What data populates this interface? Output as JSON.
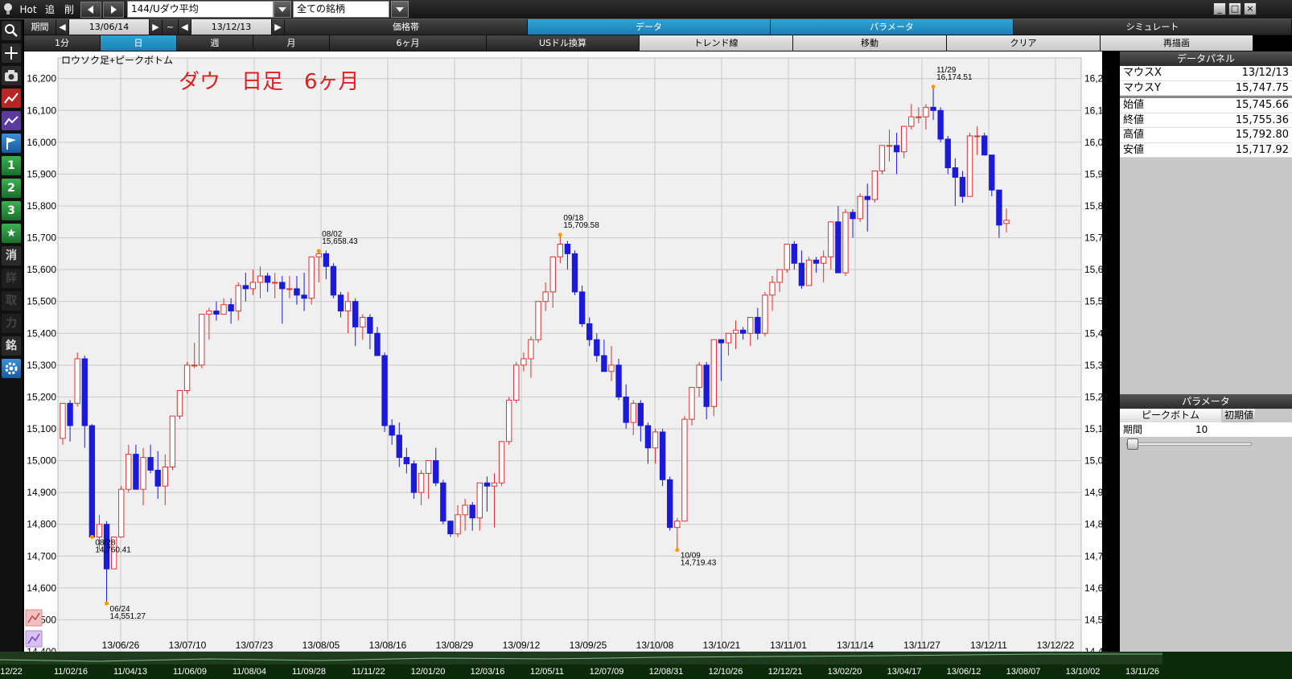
{
  "topbar": {
    "hot": "Hot",
    "add": "追",
    "del": "削",
    "symbol": "144/Uダウ平均",
    "universe": "全ての銘柄"
  },
  "toolbar_row1": {
    "period_label": "期間",
    "from": "13/06/14",
    "tilde": "~",
    "to": "13/12/13",
    "price_band": "価格帯",
    "data": "データ",
    "params": "パラメータ",
    "simulate": "シミュレート"
  },
  "toolbar_row2": {
    "min1": "1分",
    "day": "日",
    "week": "週",
    "month": "月",
    "m6": "6ヶ月",
    "usd": "USドル換算",
    "trend": "トレンド線",
    "move": "移動",
    "clear": "クリア",
    "redraw": "再描画"
  },
  "chart": {
    "legend": "ロウソク足+ピークボトム",
    "title": "ダウ　日足　6ヶ月"
  },
  "data_panel": {
    "title": "データパネル",
    "mouse_x_label": "マウスX",
    "mouse_x": "13/12/13",
    "mouse_y_label": "マウスY",
    "mouse_y": "15,747.75",
    "open_label": "始値",
    "open": "15,745.66",
    "close_label": "終値",
    "close": "15,755.36",
    "high_label": "高値",
    "high": "15,792.80",
    "low_label": "安値",
    "low": "15,717.92"
  },
  "param_panel": {
    "title": "パラメータ",
    "tab": "ピークボトム",
    "init": "初期値",
    "period_label": "期間",
    "period_value": "10"
  },
  "bottom_dates": [
    "12/22",
    "11/02/16",
    "11/04/13",
    "11/06/09",
    "11/08/04",
    "11/09/28",
    "11/11/22",
    "12/01/20",
    "12/03/16",
    "12/05/11",
    "12/07/09",
    "12/08/31",
    "12/10/26",
    "12/12/21",
    "13/02/20",
    "13/04/17",
    "13/06/12",
    "13/08/07",
    "13/10/02",
    "13/11/26"
  ],
  "colors": {
    "up": "#e03030",
    "down": "#1a1ad8",
    "peak": "#ff9900",
    "title": "#e02020"
  },
  "chart_data": {
    "type": "candlestick",
    "yticks": [
      14400,
      14500,
      14600,
      14700,
      14800,
      14900,
      15000,
      15100,
      15200,
      15300,
      15400,
      15500,
      15600,
      15700,
      15800,
      15900,
      16000,
      16100,
      16200
    ],
    "ylim": [
      14400,
      16265
    ],
    "xticks": [
      "13/06/26",
      "13/07/10",
      "13/07/23",
      "13/08/05",
      "13/08/16",
      "13/08/29",
      "13/09/12",
      "13/09/25",
      "13/10/08",
      "13/10/21",
      "13/11/01",
      "13/11/14",
      "13/11/27",
      "13/12/11",
      "13/12/22"
    ],
    "annotations": [
      {
        "date": "06/24",
        "value": "14,551.27"
      },
      {
        "date": "08/02",
        "value": "15,658.43"
      },
      {
        "date": "08/28",
        "value": "14,760.41"
      },
      {
        "date": "09/18",
        "value": "15,709.58"
      },
      {
        "date": "10/09",
        "value": "14,719.43"
      },
      {
        "date": "11/29",
        "value": "16,174.51"
      }
    ],
    "candles": [
      [
        15070,
        15180,
        15050,
        15180
      ],
      [
        15180,
        15190,
        15060,
        15110
      ],
      [
        15180,
        15340,
        15170,
        15320
      ],
      [
        15320,
        15330,
        15040,
        15110
      ],
      [
        15110,
        15115,
        14760,
        14760
      ],
      [
        14760,
        14830,
        14720,
        14800
      ],
      [
        14800,
        14810,
        14551,
        14660
      ],
      [
        14660,
        14760,
        14660,
        14760
      ],
      [
        14760,
        14920,
        14760,
        14910
      ],
      [
        14910,
        15050,
        14900,
        15020
      ],
      [
        15020,
        15050,
        14910,
        14910
      ],
      [
        14910,
        15040,
        14860,
        15010
      ],
      [
        15010,
        15050,
        14960,
        14970
      ],
      [
        14970,
        15030,
        14880,
        14920
      ],
      [
        14920,
        15020,
        14860,
        14980
      ],
      [
        14980,
        15140,
        14970,
        15140
      ],
      [
        15140,
        15220,
        15130,
        15220
      ],
      [
        15220,
        15310,
        15210,
        15300
      ],
      [
        15300,
        15370,
        15290,
        15300
      ],
      [
        15300,
        15460,
        15290,
        15460
      ],
      [
        15460,
        15480,
        15380,
        15470
      ],
      [
        15470,
        15500,
        15440,
        15460
      ],
      [
        15460,
        15510,
        15460,
        15490
      ],
      [
        15490,
        15510,
        15430,
        15470
      ],
      [
        15470,
        15560,
        15440,
        15550
      ],
      [
        15550,
        15590,
        15500,
        15540
      ],
      [
        15540,
        15600,
        15520,
        15560
      ],
      [
        15560,
        15610,
        15510,
        15580
      ],
      [
        15580,
        15590,
        15530,
        15560
      ],
      [
        15560,
        15590,
        15510,
        15560
      ],
      [
        15560,
        15580,
        15430,
        15540
      ],
      [
        15540,
        15580,
        15510,
        15540
      ],
      [
        15540,
        15580,
        15490,
        15520
      ],
      [
        15520,
        15590,
        15470,
        15510
      ],
      [
        15510,
        15640,
        15490,
        15640
      ],
      [
        15640,
        15658,
        15560,
        15650
      ],
      [
        15650,
        15660,
        15570,
        15610
      ],
      [
        15610,
        15620,
        15510,
        15520
      ],
      [
        15520,
        15530,
        15450,
        15470
      ],
      [
        15470,
        15530,
        15400,
        15500
      ],
      [
        15500,
        15510,
        15360,
        15420
      ],
      [
        15420,
        15460,
        15380,
        15450
      ],
      [
        15450,
        15460,
        15350,
        15400
      ],
      [
        15400,
        15420,
        15330,
        15330
      ],
      [
        15330,
        15340,
        15090,
        15110
      ],
      [
        15110,
        15130,
        15050,
        15080
      ],
      [
        15080,
        15120,
        14980,
        15010
      ],
      [
        15010,
        15040,
        14960,
        14990
      ],
      [
        14990,
        15000,
        14880,
        14900
      ],
      [
        14900,
        14970,
        14860,
        14960
      ],
      [
        14960,
        15000,
        14880,
        15000
      ],
      [
        15000,
        15040,
        14920,
        14930
      ],
      [
        14930,
        14940,
        14800,
        14810
      ],
      [
        14810,
        14810,
        14760,
        14770
      ],
      [
        14770,
        14860,
        14760,
        14830
      ],
      [
        14830,
        14880,
        14780,
        14860
      ],
      [
        14860,
        14870,
        14780,
        14820
      ],
      [
        14820,
        14930,
        14780,
        14930
      ],
      [
        14930,
        14950,
        14840,
        14920
      ],
      [
        14920,
        14960,
        14790,
        14930
      ],
      [
        14930,
        15060,
        14920,
        15060
      ],
      [
        15060,
        15200,
        15050,
        15190
      ],
      [
        15190,
        15310,
        15180,
        15300
      ],
      [
        15300,
        15340,
        15280,
        15320
      ],
      [
        15320,
        15390,
        15260,
        15380
      ],
      [
        15380,
        15500,
        15370,
        15500
      ],
      [
        15500,
        15560,
        15470,
        15530
      ],
      [
        15530,
        15640,
        15480,
        15640
      ],
      [
        15640,
        15709,
        15620,
        15680
      ],
      [
        15680,
        15690,
        15600,
        15650
      ],
      [
        15650,
        15660,
        15520,
        15530
      ],
      [
        15530,
        15550,
        15420,
        15430
      ],
      [
        15430,
        15450,
        15360,
        15380
      ],
      [
        15380,
        15400,
        15310,
        15330
      ],
      [
        15330,
        15380,
        15290,
        15280
      ],
      [
        15280,
        15360,
        15250,
        15300
      ],
      [
        15300,
        15320,
        15190,
        15200
      ],
      [
        15200,
        15240,
        15100,
        15120
      ],
      [
        15120,
        15190,
        15080,
        15180
      ],
      [
        15180,
        15190,
        15060,
        15110
      ],
      [
        15110,
        15120,
        14990,
        15040
      ],
      [
        15040,
        15100,
        14990,
        15090
      ],
      [
        15090,
        15100,
        14920,
        14940
      ],
      [
        14940,
        14950,
        14780,
        14790
      ],
      [
        14790,
        14820,
        14719,
        14810
      ],
      [
        14810,
        15140,
        14810,
        15130
      ],
      [
        15130,
        15230,
        15110,
        15230
      ],
      [
        15230,
        15310,
        15200,
        15300
      ],
      [
        15300,
        15310,
        15130,
        15170
      ],
      [
        15170,
        15380,
        15140,
        15380
      ],
      [
        15380,
        15380,
        15250,
        15370
      ],
      [
        15370,
        15400,
        15330,
        15400
      ],
      [
        15400,
        15440,
        15350,
        15410
      ],
      [
        15410,
        15420,
        15380,
        15400
      ],
      [
        15400,
        15450,
        15360,
        15450
      ],
      [
        15450,
        15480,
        15380,
        15400
      ],
      [
        15400,
        15530,
        15390,
        15520
      ],
      [
        15520,
        15580,
        15470,
        15560
      ],
      [
        15560,
        15600,
        15530,
        15600
      ],
      [
        15600,
        15680,
        15590,
        15680
      ],
      [
        15680,
        15690,
        15600,
        15620
      ],
      [
        15620,
        15660,
        15540,
        15550
      ],
      [
        15550,
        15640,
        15550,
        15630
      ],
      [
        15630,
        15640,
        15590,
        15620
      ],
      [
        15620,
        15660,
        15560,
        15640
      ],
      [
        15640,
        15730,
        15600,
        15750
      ],
      [
        15750,
        15800,
        15590,
        15590
      ],
      [
        15590,
        15790,
        15580,
        15780
      ],
      [
        15780,
        15790,
        15700,
        15760
      ],
      [
        15760,
        15840,
        15750,
        15830
      ],
      [
        15830,
        15870,
        15720,
        15820
      ],
      [
        15820,
        15910,
        15810,
        15910
      ],
      [
        15910,
        15990,
        15900,
        15990
      ],
      [
        15990,
        16040,
        15940,
        15990
      ],
      [
        15990,
        16030,
        15900,
        15970
      ],
      [
        15970,
        16050,
        15950,
        16050
      ],
      [
        16050,
        16120,
        16040,
        16080
      ],
      [
        16080,
        16110,
        16060,
        16080
      ],
      [
        16080,
        16120,
        16040,
        16110
      ],
      [
        16110,
        16174,
        16070,
        16100
      ],
      [
        16100,
        16110,
        16000,
        16010
      ],
      [
        16010,
        16020,
        15900,
        15920
      ],
      [
        15920,
        15950,
        15800,
        15890
      ],
      [
        15890,
        15910,
        15810,
        15830
      ],
      [
        15830,
        16030,
        15830,
        16020
      ],
      [
        16020,
        16050,
        15960,
        16020
      ],
      [
        16020,
        16030,
        15960,
        15960
      ],
      [
        15960,
        15960,
        15830,
        15850
      ],
      [
        15850,
        15850,
        15700,
        15740
      ],
      [
        15745,
        15792,
        15717,
        15755
      ]
    ]
  }
}
